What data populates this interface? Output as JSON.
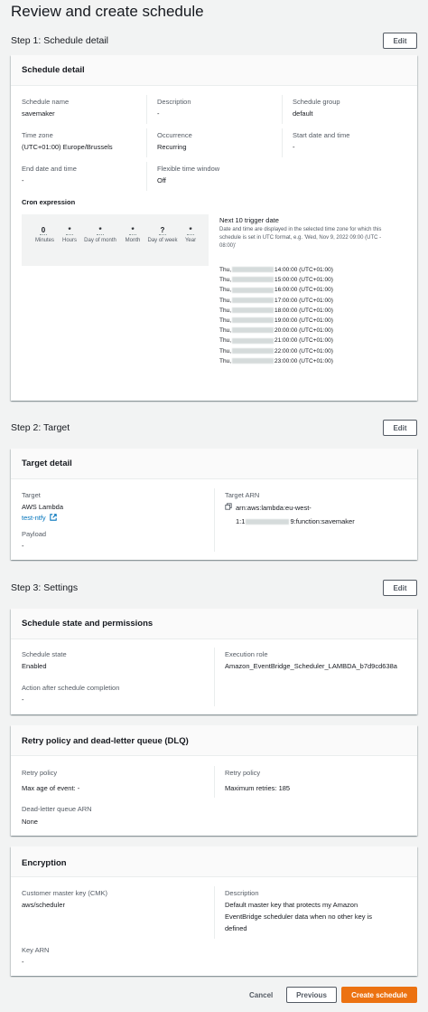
{
  "page_title": "Review and create schedule",
  "edit_label": "Edit",
  "step1": {
    "title": "Step 1: Schedule detail",
    "card_title": "Schedule detail",
    "schedule_name_label": "Schedule name",
    "schedule_name": "savemaker",
    "description_label": "Description",
    "description": "-",
    "schedule_group_label": "Schedule group",
    "schedule_group": "default",
    "time_zone_label": "Time zone",
    "time_zone": "(UTC+01:00) Europe/Brussels",
    "occurrence_label": "Occurrence",
    "occurrence": "Recurring",
    "start_label": "Start date and time",
    "start": "-",
    "end_label": "End date and time",
    "end": "-",
    "flex_label": "Flexible time window",
    "flex": "Off",
    "cron_label": "Cron expression",
    "cron": [
      {
        "value": "0",
        "label": "Minutes"
      },
      {
        "value": "*",
        "label": "Hours"
      },
      {
        "value": "*",
        "label": "Day of month"
      },
      {
        "value": "*",
        "label": "Month"
      },
      {
        "value": "?",
        "label": "Day of week"
      },
      {
        "value": "*",
        "label": "Year"
      }
    ],
    "next_title": "Next 10 trigger date",
    "next_desc1": "Date and time are displayed in the selected time zone for which this",
    "next_desc2": "schedule is set in UTC format, e.g. 'Wed, Nov 9, 2022 09:00 (UTC -",
    "next_desc3": "08:00)'",
    "triggers": [
      {
        "day": "Thu,",
        "time": "14:00:00 (UTC+01:00)"
      },
      {
        "day": "Thu,",
        "time": "15:00:00 (UTC+01:00)"
      },
      {
        "day": "Thu,",
        "time": "16:00:00 (UTC+01:00)"
      },
      {
        "day": "Thu,",
        "time": "17:00:00 (UTC+01:00)"
      },
      {
        "day": "Thu,",
        "time": "18:00:00 (UTC+01:00)"
      },
      {
        "day": "Thu,",
        "time": "19:00:00 (UTC+01:00)"
      },
      {
        "day": "Thu,",
        "time": "20:00:00 (UTC+01:00)"
      },
      {
        "day": "Thu,",
        "time": "21:00:00 (UTC+01:00)"
      },
      {
        "day": "Thu,",
        "time": "22:00:00 (UTC+01:00)"
      },
      {
        "day": "Thu,",
        "time": "23:00:00 (UTC+01:00)"
      }
    ]
  },
  "step2": {
    "title": "Step 2: Target",
    "card_title": "Target detail",
    "target_label": "Target",
    "target": "AWS Lambda",
    "target_link": "test-ntfy",
    "arn_label": "Target ARN",
    "arn_line1": "arn:aws:lambda:eu-west-",
    "arn_line2_prefix": "1:1",
    "arn_line2_suffix": "9:function:savemaker",
    "payload_label": "Payload",
    "payload": "-"
  },
  "step3": {
    "title": "Step 3: Settings",
    "state_card_title": "Schedule state and permissions",
    "state_label": "Schedule state",
    "state": "Enabled",
    "role_label": "Execution role",
    "role": "Amazon_EventBridge_Scheduler_LAMBDA_b7d9cd638a",
    "action_label": "Action after schedule completion",
    "action": "-",
    "retry_card_title": "Retry policy and dead-letter queue (DLQ)",
    "retry_label1": "Retry policy",
    "retry_val1": "Max age of event: -",
    "retry_label2": "Retry policy",
    "retry_val2": "Maximum retries: 185",
    "dlq_label": "Dead-letter queue ARN",
    "dlq": "None",
    "enc_card_title": "Encryption",
    "cmk_label": "Customer master key (CMK)",
    "cmk": "aws/scheduler",
    "desc_label": "Description",
    "desc1": "Default master key that protects my Amazon",
    "desc2": "EventBridge scheduler data when no other key is",
    "desc3": "defined",
    "key_arn_label": "Key ARN",
    "key_arn": "-"
  },
  "footer": {
    "cancel": "Cancel",
    "previous": "Previous",
    "create": "Create schedule"
  }
}
